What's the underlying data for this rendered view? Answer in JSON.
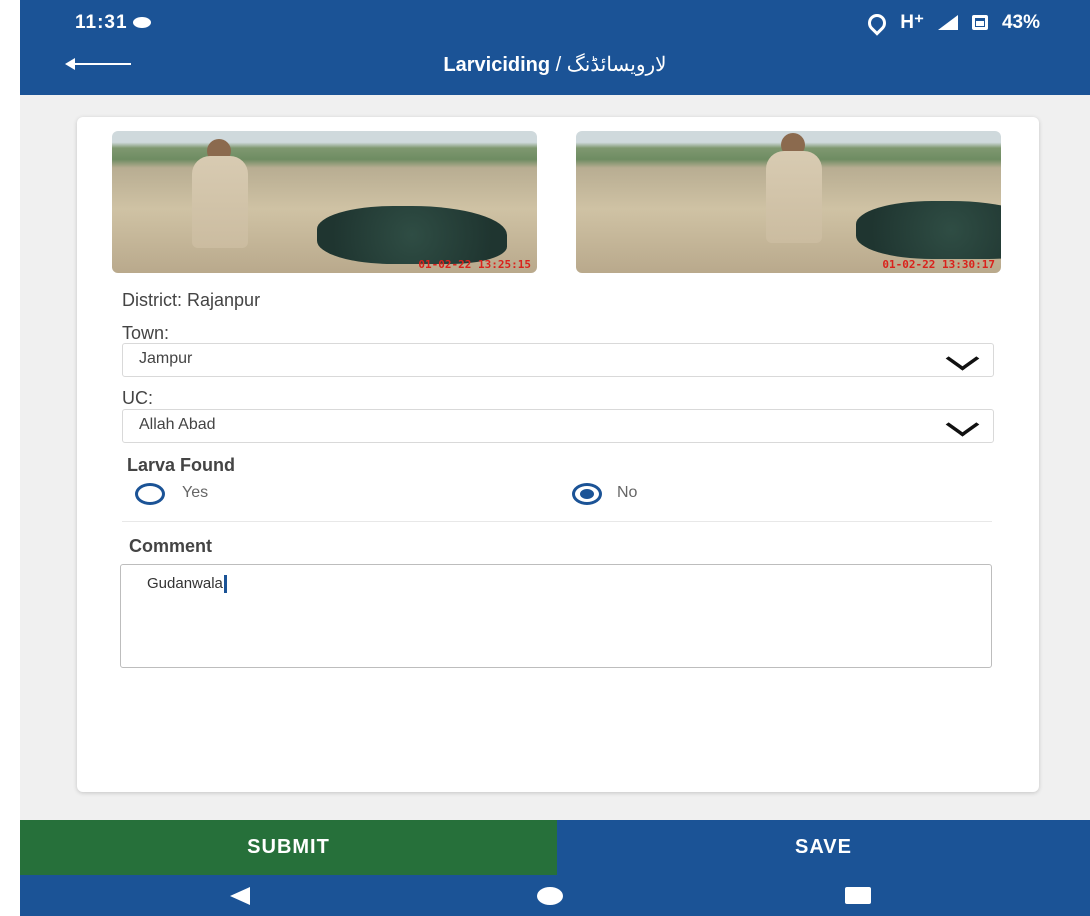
{
  "status": {
    "time": "11:31",
    "network": "H⁺",
    "battery": "43%"
  },
  "header": {
    "title_en": "Larviciding",
    "title_sep": " / ",
    "title_ur": "لارویسائڈنگ"
  },
  "photos": [
    {
      "stamp": "01-02-22 13:25:15"
    },
    {
      "stamp": "01-02-22 13:30:17"
    }
  ],
  "form": {
    "district_label": "District:",
    "district_value": "Rajanpur",
    "town_label": "Town:",
    "town_value": "Jampur",
    "uc_label": "UC:",
    "uc_value": "Allah Abad",
    "larva_label": "Larva Found",
    "yes_label": "Yes",
    "no_label": "No",
    "larva_selected": "No",
    "comment_label": "Comment",
    "comment_value": "Gudanwala"
  },
  "actions": {
    "submit_label": "SUBMIT",
    "save_label": "SAVE"
  },
  "colors": {
    "primary": "#1b5396",
    "submit": "#26703a",
    "stamp": "#d9221c"
  }
}
